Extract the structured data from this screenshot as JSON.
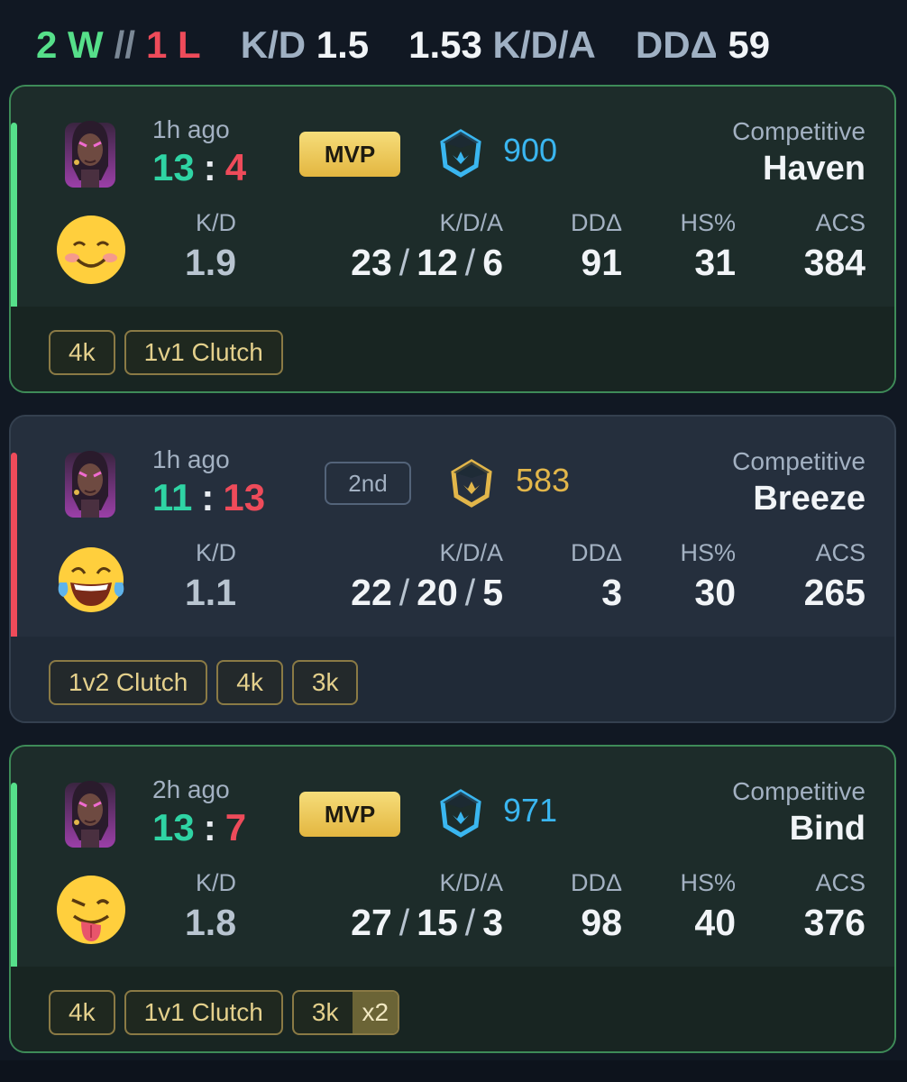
{
  "summary": {
    "wins": "2 W",
    "separator": "//",
    "losses": "1 L",
    "kd_label": "K/D",
    "kd_value": "1.5",
    "kda_value": "1.53",
    "kda_label": "K/D/A",
    "dd_label": "DDΔ",
    "dd_value": "59"
  },
  "stat_labels": {
    "kd": "K/D",
    "kda": "K/D/A",
    "dd": "DDΔ",
    "hs": "HS%",
    "acs": "ACS"
  },
  "matches": [
    {
      "result": "win",
      "time_ago": "1h ago",
      "score_team": "13",
      "score_sep": ":",
      "score_enemy": "4",
      "badge": "MVP",
      "badge_type": "mvp",
      "rr_tier_color": "#3ab6f0",
      "rr_value": "900",
      "mode": "Competitive",
      "map": "Haven",
      "emoji": "smiling-face-icon",
      "kd": "1.9",
      "kills": "23",
      "deaths": "12",
      "assists": "6",
      "dd": "91",
      "hs": "31",
      "acs": "384",
      "tags": [
        {
          "label": "4k"
        },
        {
          "label": "1v1 Clutch"
        }
      ]
    },
    {
      "result": "loss",
      "time_ago": "1h ago",
      "score_team": "11",
      "score_sep": ":",
      "score_enemy": "13",
      "badge": "2nd",
      "badge_type": "rank",
      "rr_tier_color": "#e2b64a",
      "rr_value": "583",
      "mode": "Competitive",
      "map": "Breeze",
      "emoji": "tears-of-joy-icon",
      "kd": "1.1",
      "kills": "22",
      "deaths": "20",
      "assists": "5",
      "dd": "3",
      "hs": "30",
      "acs": "265",
      "tags": [
        {
          "label": "1v2 Clutch"
        },
        {
          "label": "4k"
        },
        {
          "label": "3k"
        }
      ]
    },
    {
      "result": "win",
      "time_ago": "2h ago",
      "score_team": "13",
      "score_sep": ":",
      "score_enemy": "7",
      "badge": "MVP",
      "badge_type": "mvp",
      "rr_tier_color": "#3ab6f0",
      "rr_value": "971",
      "mode": "Competitive",
      "map": "Bind",
      "emoji": "winking-tongue-icon",
      "kd": "1.8",
      "kills": "27",
      "deaths": "15",
      "assists": "3",
      "dd": "98",
      "hs": "40",
      "acs": "376",
      "tags": [
        {
          "label": "4k"
        },
        {
          "label": "1v1 Clutch"
        },
        {
          "label": "3k",
          "multiplier": "x2"
        }
      ]
    }
  ]
}
